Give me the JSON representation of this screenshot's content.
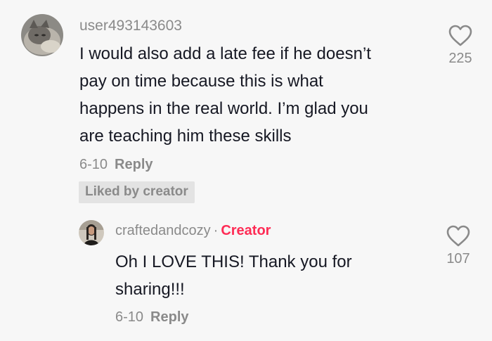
{
  "comment": {
    "username": "user493143603",
    "text_lines": [
      "I would also add a late fee if he doesn’t",
      "pay on time because this is what",
      "happens in the real world. I’m glad you",
      "are teaching him these skills"
    ],
    "date": "6-10",
    "reply_label": "Reply",
    "liked_badge": "Liked by creator",
    "like_count": "225",
    "avatar_icon": "cat-avatar-icon",
    "like_icon": "heart-outline-icon"
  },
  "reply": {
    "username": "craftedandcozy",
    "separator": "·",
    "creator_label": "Creator",
    "text_lines": [
      "Oh I LOVE THIS! Thank you for",
      "sharing!!!"
    ],
    "date": "6-10",
    "reply_label": "Reply",
    "like_count": "107",
    "avatar_icon": "person-avatar-icon",
    "like_icon": "heart-outline-icon"
  },
  "colors": {
    "background": "#f7f7f7",
    "muted": "#8a8a8a",
    "text": "#161823",
    "creator_accent": "#fe2c55",
    "badge_bg": "#e3e3e3"
  }
}
